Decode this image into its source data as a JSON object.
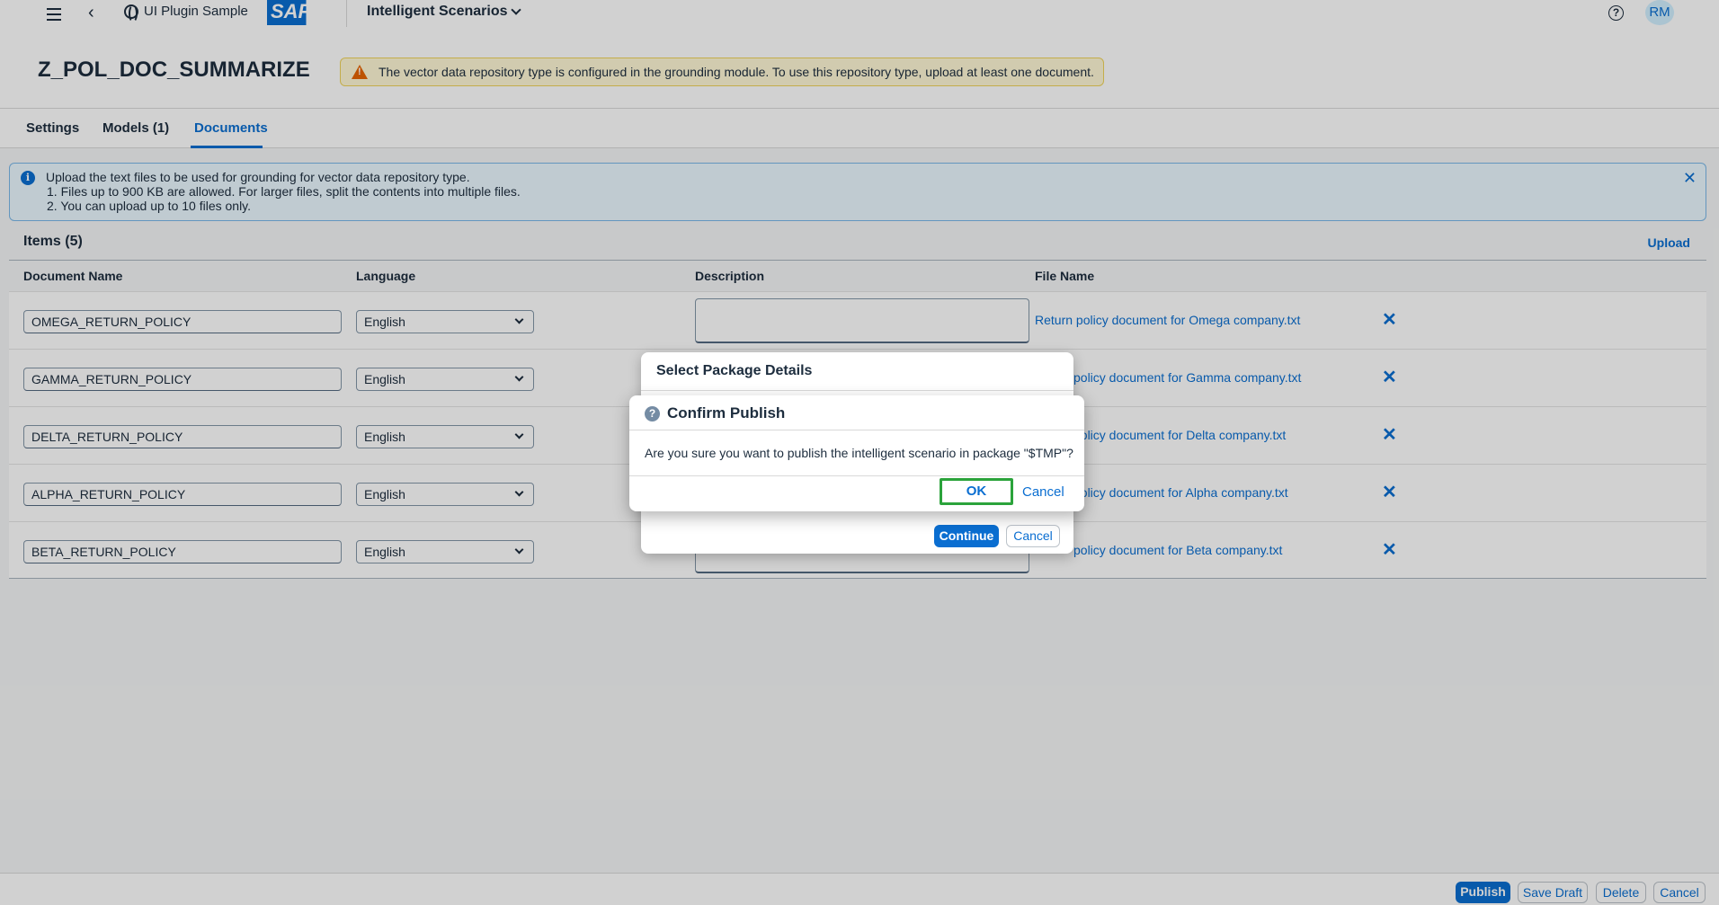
{
  "shell": {
    "plugin_label": "UI Plugin Sample",
    "logo_text": "SAP",
    "scenarios_label": "Intelligent Scenarios",
    "avatar_initials": "RM",
    "help_glyph": "?"
  },
  "header": {
    "title": "Z_POL_DOC_SUMMARIZE",
    "warning": "The vector data repository type is configured in the grounding module. To use this repository type, upload at least one document."
  },
  "tabs": [
    {
      "label": "Settings"
    },
    {
      "label": "Models (1)"
    },
    {
      "label": "Documents"
    }
  ],
  "info": {
    "line1": "Upload the text files to be used for grounding for vector data repository type.",
    "line2": "1. Files up to 900 KB are allowed. For larger files, split the contents into multiple files.",
    "line3": "2. You can upload up to 10 files only."
  },
  "items": {
    "title": "Items (5)",
    "upload_label": "Upload",
    "columns": [
      "Document Name",
      "Language",
      "Description",
      "File Name"
    ],
    "rows": [
      {
        "name": "OMEGA_RETURN_POLICY",
        "language": "English",
        "description": "",
        "file": "Return policy document for Omega company.txt"
      },
      {
        "name": "GAMMA_RETURN_POLICY",
        "language": "English",
        "description": "",
        "file": "policy document for Gamma company.txt"
      },
      {
        "name": "DELTA_RETURN_POLICY",
        "language": "English",
        "description": "",
        "file": "policy document for Delta company.txt"
      },
      {
        "name": "ALPHA_RETURN_POLICY",
        "language": "English",
        "description": "",
        "file": "policy document for Alpha company.txt"
      },
      {
        "name": "BETA_RETURN_POLICY",
        "language": "English",
        "description": "",
        "file": "policy document for Beta company.txt"
      }
    ]
  },
  "package_dialog": {
    "title": "Select Package Details",
    "continue_label": "Continue",
    "cancel_label": "Cancel"
  },
  "confirm_dialog": {
    "title": "Confirm Publish",
    "message": "Are you sure you want to publish the intelligent scenario in package \"$TMP\"?",
    "ok_label": "OK",
    "cancel_label": "Cancel"
  },
  "footer": {
    "publish": "Publish",
    "save_draft": "Save Draft",
    "delete": "Delete",
    "cancel": "Cancel"
  },
  "colors": {
    "accent": "#0a6ed1",
    "warning": "#e76500",
    "focus_outline": "#2ba33b"
  }
}
